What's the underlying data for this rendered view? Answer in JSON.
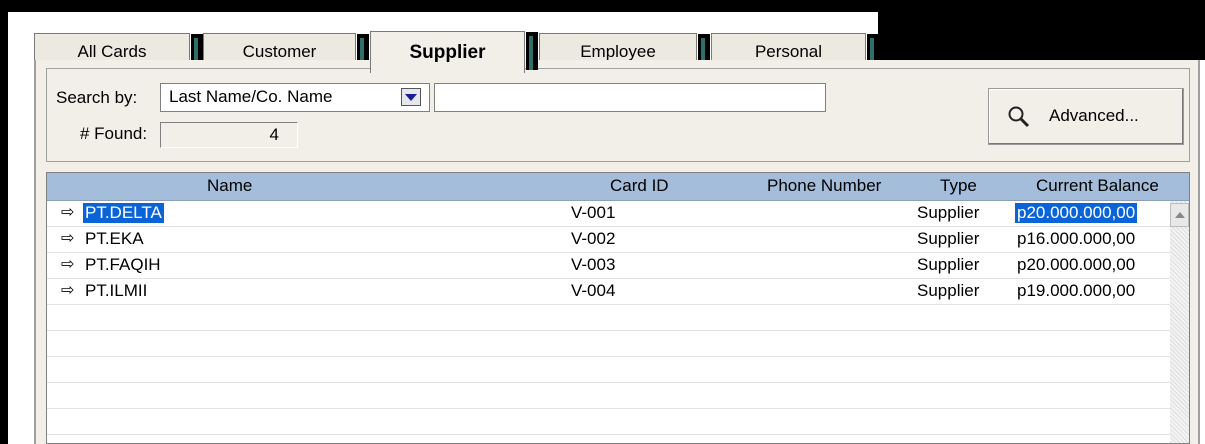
{
  "tabs": [
    {
      "label": "All Cards",
      "active": false
    },
    {
      "label": "Customer",
      "active": false
    },
    {
      "label": "Supplier",
      "active": true
    },
    {
      "label": "Employee",
      "active": false
    },
    {
      "label": "Personal",
      "active": false
    }
  ],
  "search": {
    "by_label": "Search by:",
    "by_value": "Last Name/Co. Name",
    "query": "",
    "found_label": "# Found:",
    "found_count": "4"
  },
  "advanced_button": {
    "label": "Advanced...",
    "icon": "magnifier-icon"
  },
  "table": {
    "columns": [
      "Name",
      "Card ID",
      "Phone Number",
      "Type",
      "Current Balance"
    ],
    "rows": [
      {
        "name": "PT.DELTA",
        "card_id": "V-001",
        "phone": "",
        "type": "Supplier",
        "balance": "p20.000.000,00",
        "selected": true
      },
      {
        "name": "PT.EKA",
        "card_id": "V-002",
        "phone": "",
        "type": "Supplier",
        "balance": "p16.000.000,00",
        "selected": false
      },
      {
        "name": "PT.FAQIH",
        "card_id": "V-003",
        "phone": "",
        "type": "Supplier",
        "balance": "p20.000.000,00",
        "selected": false
      },
      {
        "name": "PT.ILMII",
        "card_id": "V-004",
        "phone": "",
        "type": "Supplier",
        "balance": "p19.000.000,00",
        "selected": false
      }
    ],
    "row_marker_icon": "right-arrow-icon"
  },
  "colors": {
    "header_bg": "#a3bddb",
    "selection": "#0a64d8",
    "panel_bg": "#f1efe8"
  }
}
